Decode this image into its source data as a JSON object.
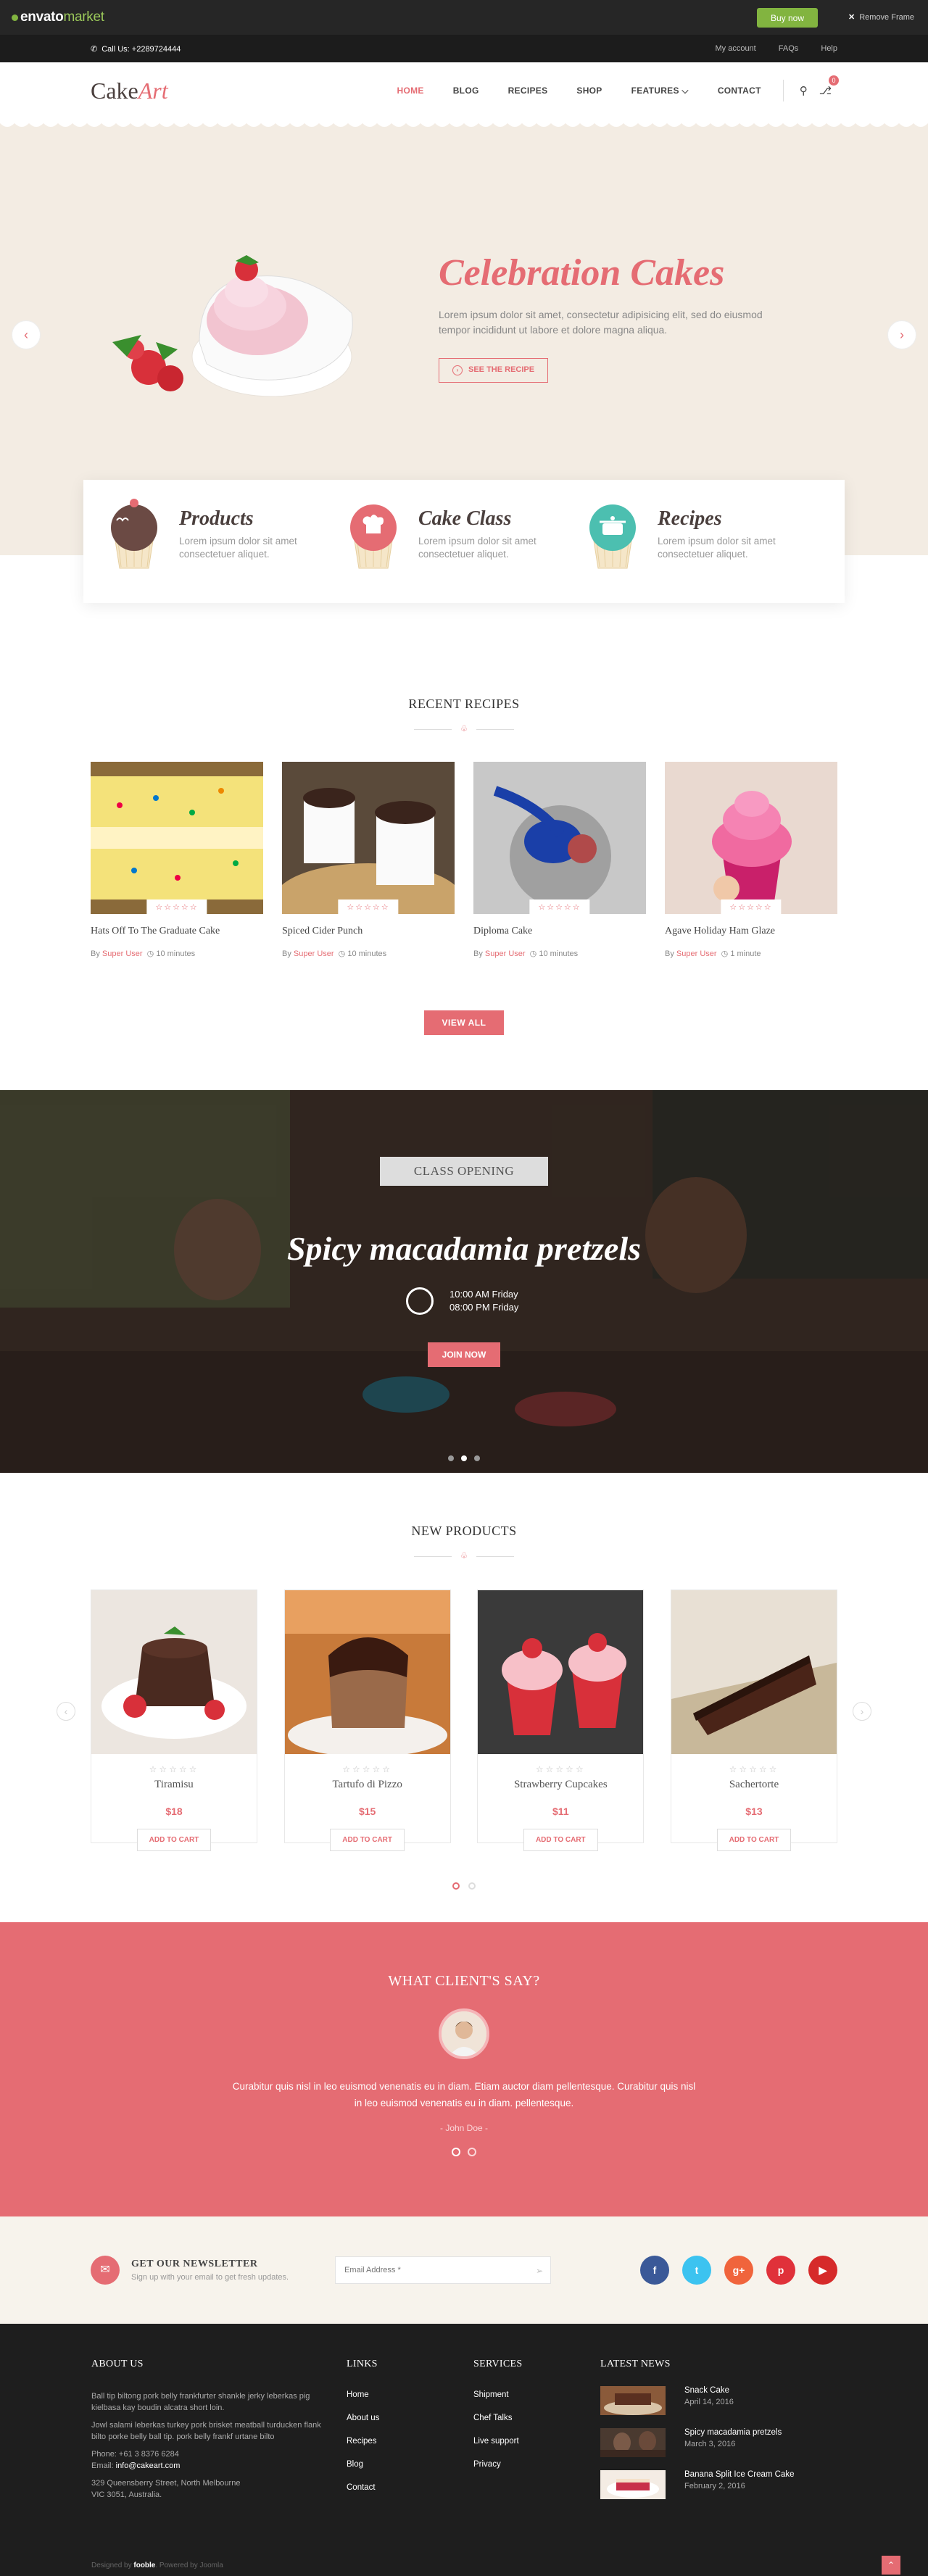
{
  "envato": {
    "brand": "envato",
    "market": "market",
    "buy_label": "Buy now",
    "remove_label": "Remove Frame"
  },
  "topbar": {
    "phone": "Call Us: +2289724444",
    "links": [
      "My account",
      "FAQs",
      "Help"
    ]
  },
  "header": {
    "logo_main": "Cake",
    "logo_accent": "Art",
    "nav": [
      "HOME",
      "BLOG",
      "RECIPES",
      "SHOP",
      "FEATURES ⌵",
      "CONTACT"
    ],
    "cart_count": "0"
  },
  "hero": {
    "title": "Celebration Cakes",
    "desc": "Lorem ipsum dolor sit amet, consectetur adipisicing elit, sed do eiusmod tempor incididunt ut labore et dolore magna aliqua.",
    "button": "SEE THE RECIPE"
  },
  "features": [
    {
      "title": "Products",
      "desc": "Lorem ipsum dolor sit amet consectetuer aliquet.",
      "color": "#6b4a44"
    },
    {
      "title": "Cake Class",
      "desc": "Lorem ipsum dolor sit amet consectetuer aliquet.",
      "color": "#e56c73"
    },
    {
      "title": "Recipes",
      "desc": "Lorem ipsum dolor sit amet consectetuer aliquet.",
      "color": "#4cbfb0"
    }
  ],
  "recent": {
    "title": "RECENT RECIPES",
    "items": [
      {
        "title": "Hats Off To The Graduate Cake",
        "by": "By ",
        "author": "Super User",
        "time": "10 minutes"
      },
      {
        "title": "Spiced Cider Punch",
        "by": "By ",
        "author": "Super User",
        "time": "10 minutes"
      },
      {
        "title": "Diploma Cake",
        "by": "By ",
        "author": "Super User",
        "time": "10 minutes"
      },
      {
        "title": "Agave Holiday Ham Glaze",
        "by": "By ",
        "author": "Super User",
        "time": "1 minute"
      }
    ],
    "stars": "☆☆☆☆☆",
    "view_all": "VIEW ALL"
  },
  "class": {
    "ribbon": "CLASS OPENING",
    "title": "Spicy macadamia pretzels",
    "time1": "10:00 AM Friday",
    "time2": "08:00 PM Friday",
    "join": "JOIN NOW"
  },
  "products": {
    "title": "NEW PRODUCTS",
    "stars": "☆☆☆☆☆",
    "add": "ADD TO CART",
    "items": [
      {
        "name": "Tiramisu",
        "price": "$18"
      },
      {
        "name": "Tartufo di Pizzo",
        "price": "$15"
      },
      {
        "name": "Strawberry Cupcakes",
        "price": "$11"
      },
      {
        "name": "Sachertorte",
        "price": "$13"
      }
    ]
  },
  "testimonial": {
    "title": "WHAT CLIENT'S SAY?",
    "text": "Curabitur quis nisl in leo euismod venenatis eu in diam. Etiam auctor diam pellentesque. Curabitur quis nisl in leo euismod venenatis eu in diam. pellentesque.",
    "author": "- John Doe -"
  },
  "newsletter": {
    "title": "GET OUR NEWSLETTER",
    "sub": "Sign up with your email to get fresh updates.",
    "placeholder": "Email Address *"
  },
  "socials": [
    {
      "icon": "facebook-icon",
      "glyph": "f",
      "color": "#3b5998"
    },
    {
      "icon": "twitter-icon",
      "glyph": "t",
      "color": "#3cc3f0"
    },
    {
      "icon": "google-plus-icon",
      "glyph": "g+",
      "color": "#f0643c"
    },
    {
      "icon": "pinterest-icon",
      "glyph": "p",
      "color": "#e0313a"
    },
    {
      "icon": "youtube-icon",
      "glyph": "▶",
      "color": "#d62a2a"
    }
  ],
  "footer": {
    "about_title": "ABOUT US",
    "about1": "Ball tip biltong pork belly frankfurter shankle jerky leberkas pig kielbasa kay boudin alcatra short loin.",
    "about2": "Jowl salami leberkas turkey pork brisket meatball turducken flank bilto porke belly ball tip. pork belly frankf urtane bilto",
    "phone": "Phone: +61 3 8376 6284",
    "email_label": "Email: ",
    "email": "info@cakeart.com",
    "addr1": "329 Queensberry Street, North Melbourne",
    "addr2": "VIC 3051, Australia.",
    "links_title": "LINKS",
    "links": [
      "Home",
      "About us",
      "Recipes",
      "Blog",
      "Contact"
    ],
    "services_title": "SERVICES",
    "services": [
      "Shipment",
      "Chef Talks",
      "Live support",
      "Privacy"
    ],
    "news_title": "LATEST NEWS",
    "news": [
      {
        "title": "Snack Cake",
        "date": "April 14, 2016"
      },
      {
        "title": "Spicy macadamia pretzels",
        "date": "March 3, 2016"
      },
      {
        "title": "Banana Split Ice Cream Cake",
        "date": "February 2, 2016"
      }
    ],
    "designed": "Designed by ",
    "designer": "fooble",
    "powered": ". Powered by Joomla"
  }
}
